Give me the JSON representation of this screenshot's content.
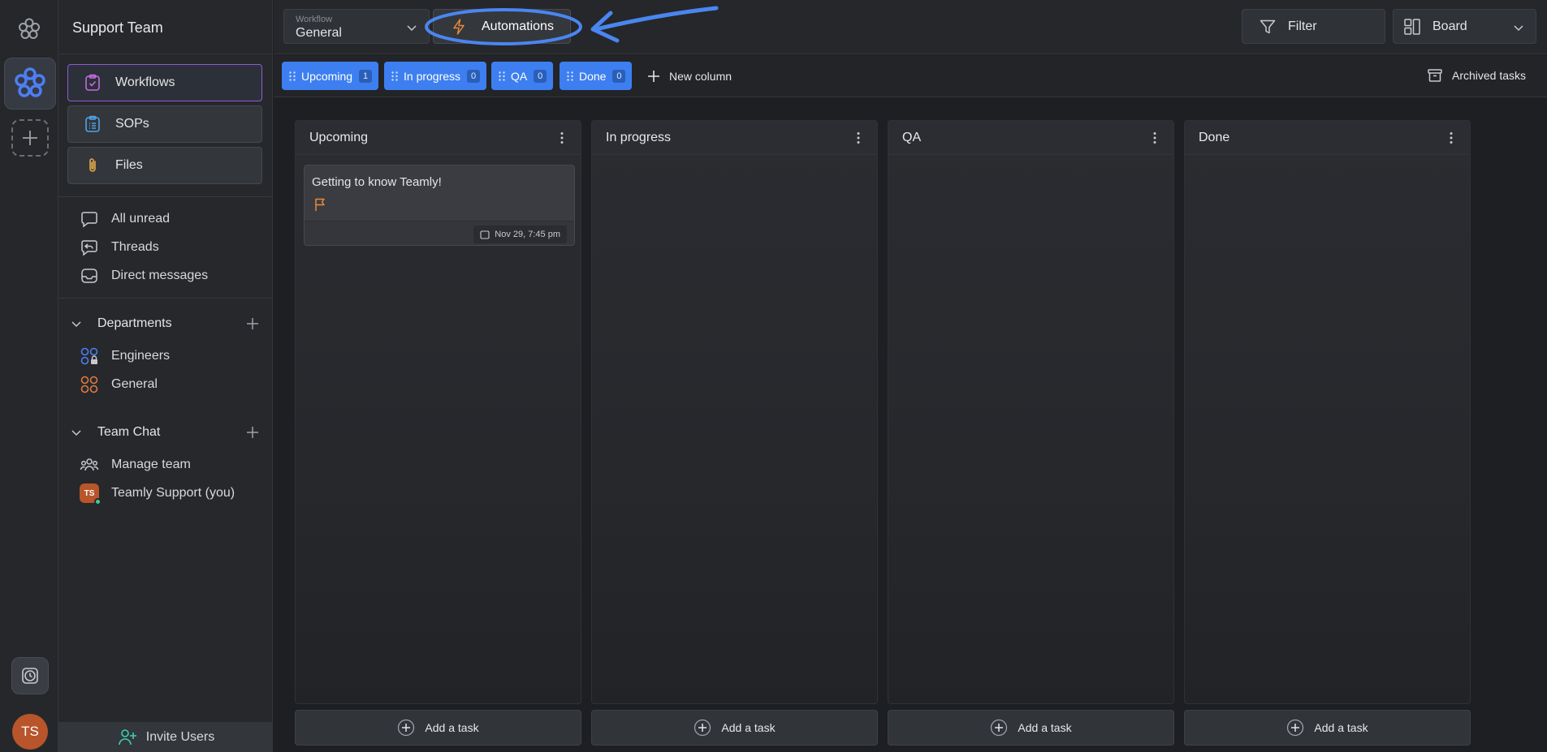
{
  "app": {
    "workspace_name": "Support Team",
    "user_initials": "TS"
  },
  "sidebar": {
    "nav_buttons": [
      {
        "label": "Workflows",
        "icon": "clipboard-check-icon",
        "active": true
      },
      {
        "label": "SOPs",
        "icon": "list-clipboard-icon",
        "active": false
      },
      {
        "label": "Files",
        "icon": "paperclip-icon",
        "active": false
      }
    ],
    "items": [
      {
        "label": "All unread",
        "icon": "chat-bubble-icon"
      },
      {
        "label": "Threads",
        "icon": "reply-bubble-icon"
      },
      {
        "label": "Direct messages",
        "icon": "inbox-icon"
      }
    ],
    "departments": {
      "title": "Departments",
      "items": [
        {
          "label": "Engineers",
          "icon": "grid-lock-icon"
        },
        {
          "label": "General",
          "icon": "grid-icon"
        }
      ]
    },
    "team_chat": {
      "title": "Team Chat",
      "items": [
        {
          "label": "Manage team",
          "icon": "people-icon"
        },
        {
          "label": "Teamly Support (you)",
          "badge": "TS"
        }
      ]
    },
    "invite_label": "Invite Users"
  },
  "topbar": {
    "workflow_label": "Workflow",
    "workflow_value": "General",
    "automations_label": "Automations",
    "filter_label": "Filter",
    "view_label": "Board"
  },
  "colbar": {
    "chips": [
      {
        "label": "Upcoming",
        "count": "1"
      },
      {
        "label": "In progress",
        "count": "0"
      },
      {
        "label": "QA",
        "count": "0"
      },
      {
        "label": "Done",
        "count": "0"
      }
    ],
    "new_column_label": "New column",
    "archived_label": "Archived tasks"
  },
  "board": {
    "columns": [
      {
        "title": "Upcoming",
        "add_label": "Add a task"
      },
      {
        "title": "In progress",
        "add_label": "Add a task"
      },
      {
        "title": "QA",
        "add_label": "Add a task"
      },
      {
        "title": "Done",
        "add_label": "Add a task"
      }
    ],
    "task": {
      "title": "Getting to know Teamly!",
      "date": "Nov 29, 7:45 pm"
    }
  },
  "colors": {
    "accent_blue": "#3d7ff0",
    "highlight_blue": "#4a86f0",
    "active_border": "#8f5bd6",
    "avatar_orange": "#b8552a",
    "flag_orange": "#e8893a"
  }
}
